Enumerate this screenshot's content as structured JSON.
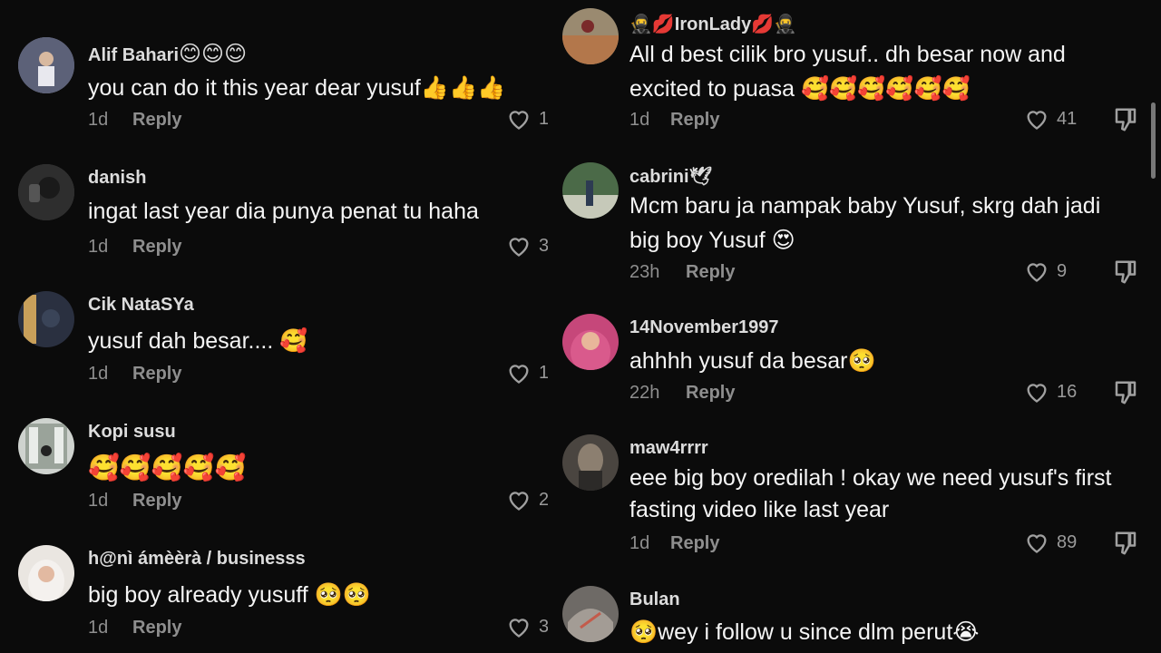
{
  "left_comments": [
    {
      "username": "Alif Bahari",
      "username_emoji": "😊😊😊",
      "text": "you can do it this year dear yusuf👍👍👍",
      "time": "1d",
      "reply": "Reply",
      "likes": "1"
    },
    {
      "username": "danish",
      "username_emoji": "",
      "text": "ingat last year dia punya penat tu haha",
      "time": "1d",
      "reply": "Reply",
      "likes": "3"
    },
    {
      "username": "Cik NataSYa",
      "username_emoji": "",
      "text": "yusuf dah besar.... 🥰",
      "time": "1d",
      "reply": "Reply",
      "likes": "1"
    },
    {
      "username": "Kopi susu",
      "username_emoji": "",
      "text": "🥰🥰🥰🥰🥰",
      "time": "1d",
      "reply": "Reply",
      "likes": "2"
    },
    {
      "username": "h@nì ámèèrà / businesss",
      "username_emoji": "",
      "text": "big boy already yusuff 🥺🥺",
      "time": "1d",
      "reply": "Reply",
      "likes": "3"
    }
  ],
  "right_comments": [
    {
      "username": "🥷💋IronLady💋🥷",
      "text_lines": [
        "All d best cilik bro yusuf.. dh besar now and",
        "excited to puasa 🥰🥰🥰🥰🥰🥰"
      ],
      "time": "1d",
      "reply": "Reply",
      "likes": "41"
    },
    {
      "username": "cabrini🕊",
      "text_lines": [
        "Mcm baru ja nampak baby Yusuf, skrg dah jadi",
        "big boy Yusuf 😍"
      ],
      "time": "23h",
      "reply": "Reply",
      "likes": "9"
    },
    {
      "username": "14November1997",
      "text_lines": [
        "ahhhh yusuf da besar🥺"
      ],
      "time": "22h",
      "reply": "Reply",
      "likes": "16"
    },
    {
      "username": "maw4rrrr",
      "text_lines": [
        "eee big boy oredilah ! okay we need yusuf's first",
        "fasting video like last year"
      ],
      "time": "1d",
      "reply": "Reply",
      "likes": "89"
    },
    {
      "username": "Bulan",
      "text_lines": [
        "🥺wey i follow u since dlm perut😭"
      ],
      "time": "",
      "reply": "",
      "likes": ""
    }
  ],
  "colors": {
    "bg": "#0b0b0b",
    "text": "#f5f5f5",
    "muted": "#8e8e8e"
  }
}
